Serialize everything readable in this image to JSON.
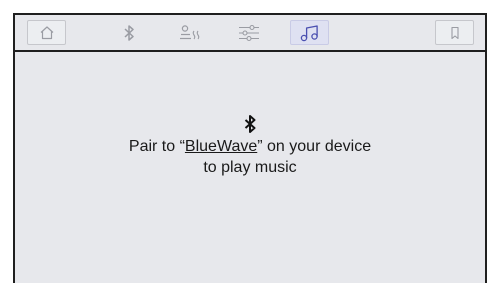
{
  "tabs": [
    {
      "icon": "home-icon",
      "active": false
    },
    {
      "icon": "bluetooth-icon",
      "active": false
    },
    {
      "icon": "heat-icon",
      "active": false
    },
    {
      "icon": "equalizer-icon",
      "active": false
    },
    {
      "icon": "music-note-icon",
      "active": true
    },
    {
      "icon": "bookmark-icon",
      "active": false
    }
  ],
  "message": {
    "icon": "bluetooth-icon",
    "prefix": "Pair to “",
    "device_name": "BlueWave",
    "suffix": "” on your device",
    "line2": "to play music"
  },
  "colors": {
    "background": "#e7e8ec",
    "active_tab": "#dfe1f2",
    "icon": "#9a9ca3",
    "active_icon": "#4a4fb0",
    "border": "#1f1f1f"
  }
}
